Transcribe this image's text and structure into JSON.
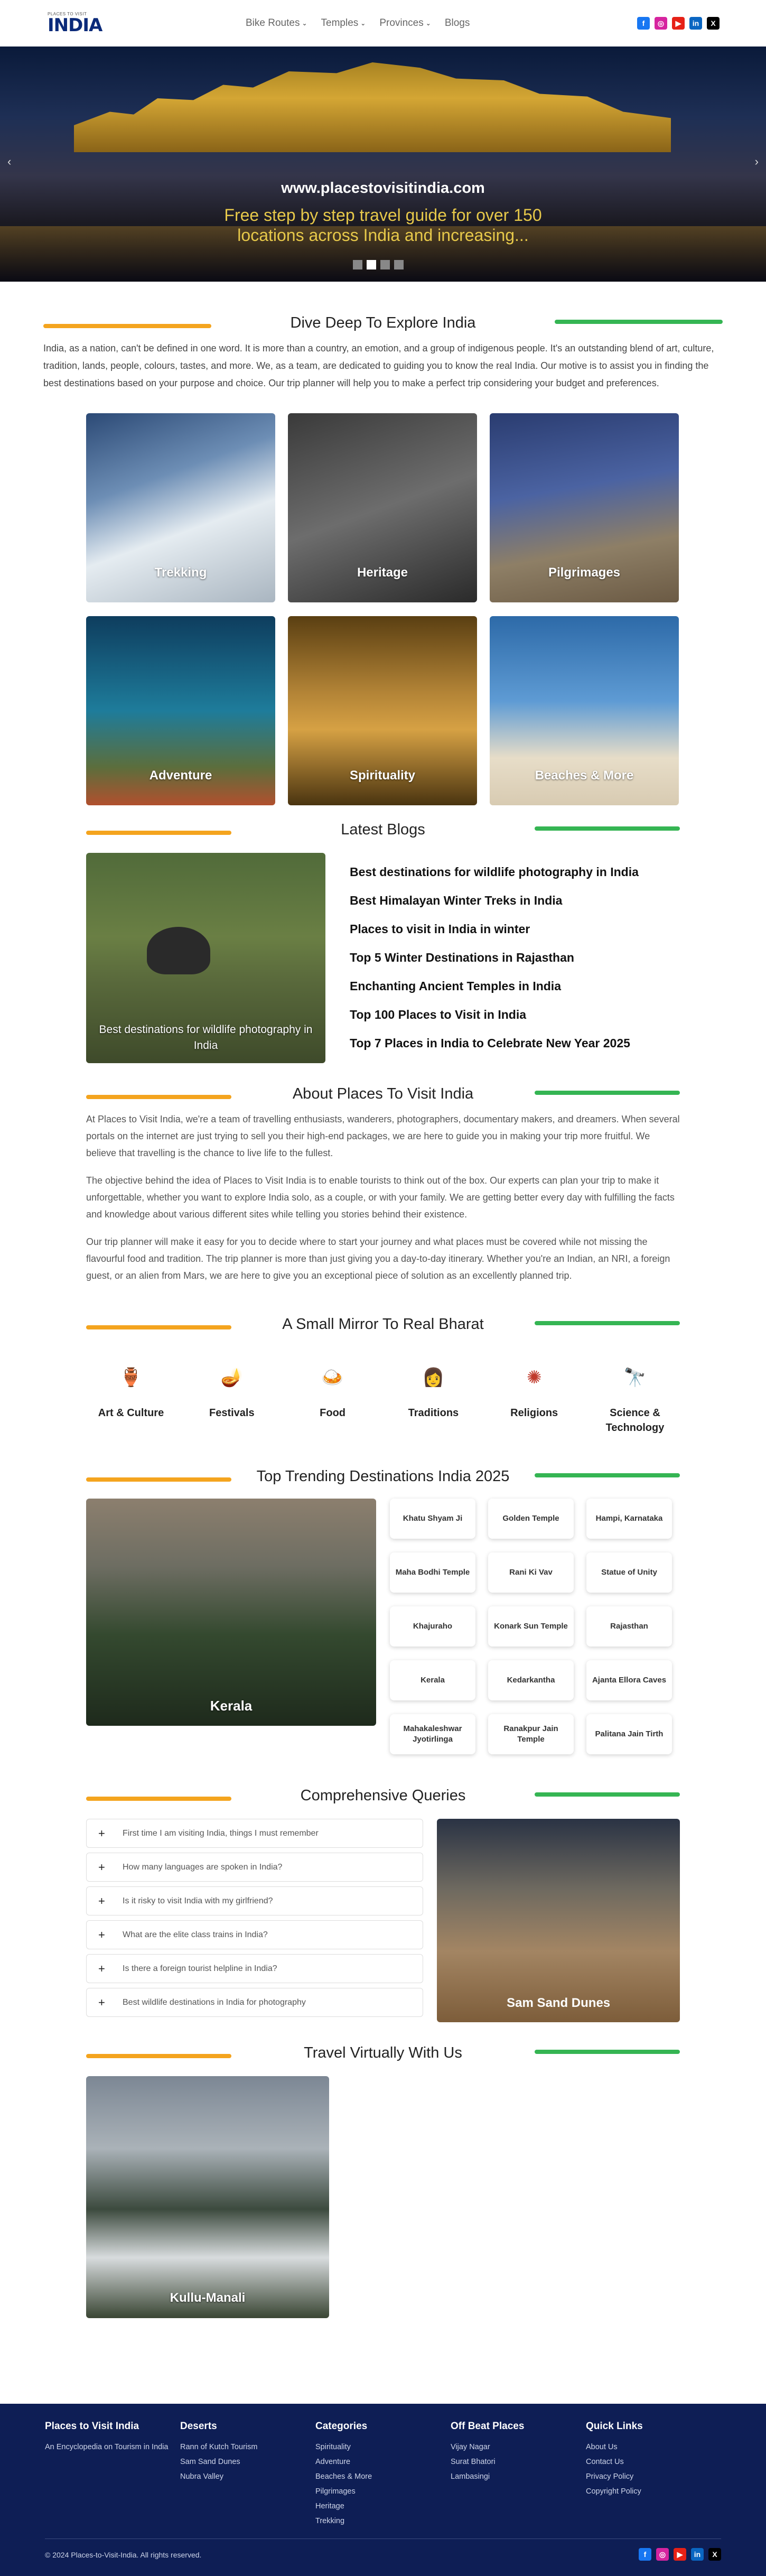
{
  "header": {
    "logo_small": "PLACES TO VISIT",
    "logo_main": "INDIA",
    "nav": [
      {
        "label": "Bike Routes",
        "has_dropdown": true
      },
      {
        "label": "Temples",
        "has_dropdown": true
      },
      {
        "label": "Provinces",
        "has_dropdown": true
      },
      {
        "label": "Blogs",
        "has_dropdown": false
      }
    ]
  },
  "hero": {
    "url": "www.placestovisitindia.com",
    "tagline": "Free step by step travel guide for over 150 locations across India and increasing...",
    "active_slide": 2,
    "slide_count": 4
  },
  "explore": {
    "title": "Dive Deep To Explore India",
    "intro": "India, as a nation, can't be defined in one word. It is more than a country, an emotion, and a group of indigenous people. It's an outstanding blend of art, culture, tradition, lands, people, colours, tastes, and more. We, as a team, are dedicated to guiding you to know the real India. Our motive is to assist you in finding the best destinations based on your purpose and choice. Our trip planner will help you to make a perfect trip considering your budget and preferences.",
    "cards": [
      "Trekking",
      "Heritage",
      "Pilgrimages",
      "Adventure",
      "Spirituality",
      "Beaches & More"
    ]
  },
  "blogs": {
    "title": "Latest Blogs",
    "featured_caption": "Best destinations for wildlife photography in India",
    "items": [
      "Best destinations for wildlife photography in India",
      "Best Himalayan Winter Treks in India",
      "Places to visit in India in winter",
      "Top 5 Winter Destinations in Rajasthan",
      "Enchanting Ancient Temples in India",
      "Top 100 Places to Visit in India",
      "Top 7 Places in India to Celebrate New Year 2025"
    ]
  },
  "about": {
    "title": "About Places To Visit India",
    "paragraphs": [
      "At Places to Visit India, we're a team of travelling enthusiasts, wanderers, photographers, documentary makers, and dreamers. When several portals on the internet are just trying to sell you their high-end packages, we are here to guide you in making your trip more fruitful. We believe that travelling is the chance to live life to the fullest.",
      "The objective behind the idea of Places to Visit India is to enable tourists to think out of the box. Our experts can plan your trip to make it unforgettable, whether you want to explore India solo, as a couple, or with your family. We are getting better every day with fulfilling the facts and knowledge about various different sites while telling you stories behind their existence.",
      "Our trip planner will make it easy for you to decide where to start your journey and what places must be covered while not missing the flavourful food and tradition. The trip planner is more than just giving you a day-to-day itinerary. Whether you're an Indian, an NRI, a foreign guest, or an alien from Mars, we are here to give you an exceptional piece of solution as an excellently planned trip."
    ]
  },
  "mirror": {
    "title": "A Small Mirror To Real Bharat",
    "items": [
      {
        "label": "Art & Culture",
        "icon": "art-culture-icon",
        "color": "#c0392b",
        "glyph": "🏺"
      },
      {
        "label": "Festivals",
        "icon": "diya-icon",
        "color": "#d35400",
        "glyph": "🪔"
      },
      {
        "label": "Food",
        "icon": "food-icon",
        "color": "#e67e22",
        "glyph": "🍛"
      },
      {
        "label": "Traditions",
        "icon": "traditions-icon",
        "color": "#e74c3c",
        "glyph": "👩"
      },
      {
        "label": "Religions",
        "icon": "religions-icon",
        "color": "#c0392b",
        "glyph": "✺"
      },
      {
        "label": "Science & Technology",
        "icon": "science-icon",
        "color": "#7f4b3c",
        "glyph": "🔭"
      }
    ]
  },
  "trending": {
    "title": "Top Trending Destinations India 2025",
    "featured": "Kerala",
    "chips": [
      "Khatu Shyam Ji",
      "Golden Temple",
      "Hampi, Karnataka",
      "Maha Bodhi Temple",
      "Rani Ki Vav",
      "Statue of Unity",
      "Khajuraho",
      "Konark Sun Temple",
      "Rajasthan",
      "Kerala",
      "Kedarkantha",
      "Ajanta Ellora Caves",
      "Mahakaleshwar Jyotirlinga",
      "Ranakpur Jain Temple",
      "Palitana Jain Tirth"
    ]
  },
  "faq": {
    "title": "Comprehensive Queries",
    "image_caption": "Sam Sand Dunes",
    "items": [
      "First time I am visiting India, things I must remember",
      "How many languages are spoken in India?",
      "Is it risky to visit India with my girlfriend?",
      "What are the elite class trains in India?",
      "Is there a foreign tourist helpline in India?",
      "Best wildlife destinations in India for photography"
    ]
  },
  "virtual": {
    "title": "Travel Virtually With Us",
    "card": "Kullu-Manali"
  },
  "footer": {
    "columns": [
      {
        "title": "Places to Visit India",
        "links": [
          "An Encyclopedia on Tourism in India"
        ]
      },
      {
        "title": "Deserts",
        "links": [
          "Rann of Kutch Tourism",
          "Sam Sand Dunes",
          "Nubra Valley"
        ]
      },
      {
        "title": "Categories",
        "links": [
          "Spirituality",
          "Adventure",
          "Beaches & More",
          "Pilgrimages",
          "Heritage",
          "Trekking"
        ]
      },
      {
        "title": "Off Beat Places",
        "links": [
          "Vijay Nagar",
          "Surat Bhatori",
          "Lambasingi"
        ]
      },
      {
        "title": "Quick Links",
        "links": [
          "About Us",
          "Contact Us",
          "Privacy Policy",
          "Copyright Policy"
        ]
      }
    ],
    "copyright": "© 2024 Places-to-Visit-India. All rights reserved."
  },
  "social": [
    {
      "icon": "facebook-icon",
      "glyph": "f"
    },
    {
      "icon": "instagram-icon",
      "glyph": "◎"
    },
    {
      "icon": "youtube-icon",
      "glyph": "▶"
    },
    {
      "icon": "linkedin-icon",
      "glyph": "in"
    },
    {
      "icon": "x-icon",
      "glyph": "X"
    }
  ]
}
